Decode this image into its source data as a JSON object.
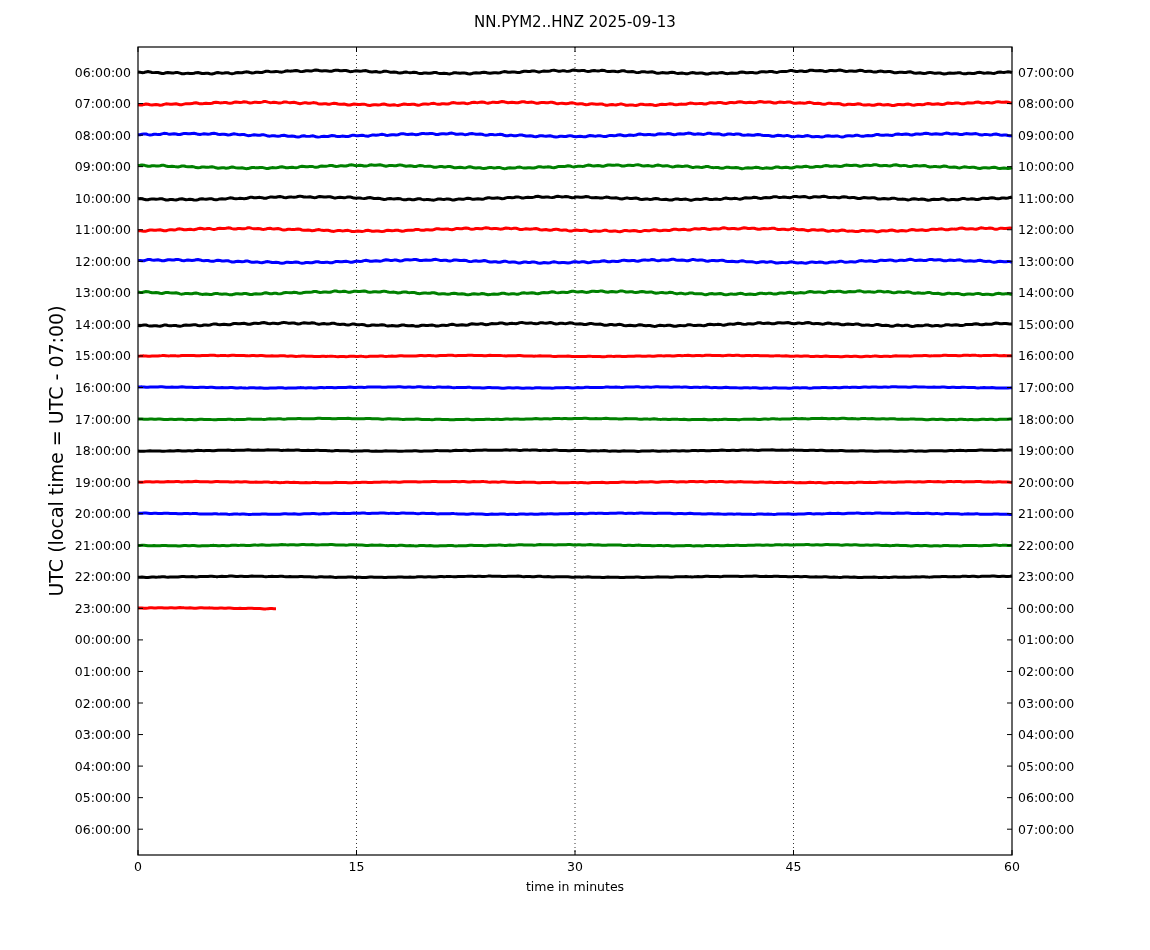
{
  "title": "NN.PYM2..HNZ 2025-09-13",
  "ylabel": "UTC (local time = UTC - 07:00)",
  "xlabel": "time in minutes",
  "left_labels": [
    "06:00:00",
    "07:00:00",
    "08:00:00",
    "09:00:00",
    "10:00:00",
    "11:00:00",
    "12:00:00",
    "13:00:00",
    "14:00:00",
    "15:00:00",
    "16:00:00",
    "17:00:00",
    "18:00:00",
    "19:00:00",
    "20:00:00",
    "21:00:00",
    "22:00:00",
    "23:00:00",
    "00:00:00",
    "01:00:00",
    "02:00:00",
    "03:00:00",
    "04:00:00",
    "05:00:00",
    "06:00:00"
  ],
  "right_labels": [
    "07:00:00",
    "08:00:00",
    "09:00:00",
    "10:00:00",
    "11:00:00",
    "12:00:00",
    "13:00:00",
    "14:00:00",
    "15:00:00",
    "16:00:00",
    "17:00:00",
    "18:00:00",
    "19:00:00",
    "20:00:00",
    "21:00:00",
    "22:00:00",
    "23:00:00",
    "00:00:00",
    "01:00:00",
    "02:00:00",
    "03:00:00",
    "04:00:00",
    "05:00:00",
    "06:00:00",
    "07:00:00"
  ],
  "x_ticks": [
    "0",
    "15",
    "30",
    "45",
    "60"
  ],
  "traces": [
    {
      "color": "#000000",
      "kind": "full"
    },
    {
      "color": "#ff0000",
      "kind": "full"
    },
    {
      "color": "#0000ff",
      "kind": "full"
    },
    {
      "color": "#008000",
      "kind": "full"
    },
    {
      "color": "#000000",
      "kind": "full"
    },
    {
      "color": "#ff0000",
      "kind": "full"
    },
    {
      "color": "#0000ff",
      "kind": "full"
    },
    {
      "color": "#008000",
      "kind": "full"
    },
    {
      "color": "#000000",
      "kind": "full"
    },
    {
      "color": "#ff0000",
      "kind": "full"
    },
    {
      "color": "#0000ff",
      "kind": "full"
    },
    {
      "color": "#008000",
      "kind": "full"
    },
    {
      "color": "#000000",
      "kind": "full"
    },
    {
      "color": "#ff0000",
      "kind": "full"
    },
    {
      "color": "#0000ff",
      "kind": "full"
    },
    {
      "color": "#008000",
      "kind": "full"
    },
    {
      "color": "#000000",
      "kind": "full"
    },
    {
      "color": "#ff0000",
      "kind": "partial"
    }
  ]
}
